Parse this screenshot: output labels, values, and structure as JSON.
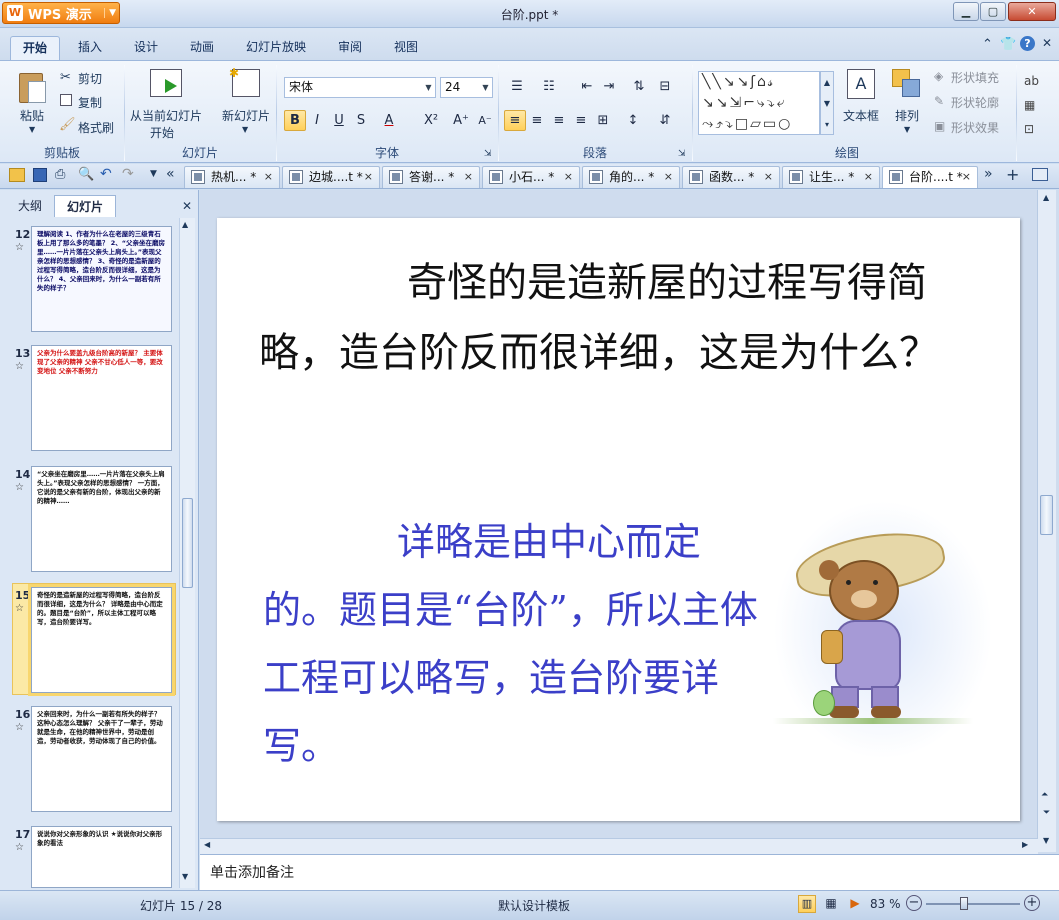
{
  "app": {
    "name": "WPS 演示",
    "window_title": "台阶.ppt *"
  },
  "menu_tabs": [
    "开始",
    "插入",
    "设计",
    "动画",
    "幻灯片放映",
    "审阅",
    "视图"
  ],
  "ribbon": {
    "clipboard": {
      "paste": "粘贴",
      "cut": "剪切",
      "copy": "复制",
      "format_painter": "格式刷",
      "label": "剪贴板"
    },
    "slides": {
      "from_current": "从当前幻灯片",
      "start": "开始",
      "new_slide": "新幻灯片",
      "label": "幻灯片"
    },
    "font": {
      "name": "宋体",
      "size": "24",
      "label": "字体"
    },
    "paragraph": {
      "label": "段落"
    },
    "drawing": {
      "textbox": "文本框",
      "arrange": "排列",
      "shape_fill": "形状填充",
      "shape_outline": "形状轮廓",
      "shape_effects": "形状效果",
      "label": "绘图"
    }
  },
  "doc_tabs": [
    {
      "label": "热机... *",
      "active": false
    },
    {
      "label": "边城....t *",
      "active": false
    },
    {
      "label": "答谢... *",
      "active": false
    },
    {
      "label": "小石... *",
      "active": false
    },
    {
      "label": "角的... *",
      "active": false
    },
    {
      "label": "函数... *",
      "active": false
    },
    {
      "label": "让生... *",
      "active": false
    },
    {
      "label": "台阶....t *",
      "active": true
    }
  ],
  "left_panel": {
    "tabs": [
      "大纲",
      "幻灯片"
    ],
    "thumbnails": [
      {
        "num": "12",
        "text": "理解阅读 1、作者为什么在老屋的三级青石板上用了那么多的笔墨？ 2、“父亲坐在磨房里……一片片落在父亲头上肩头上。”表现父亲怎样的思想感情？ 3、奇怪的是造新屋的过程写得简略，造台阶反而很详细，这是为什么？ 4、父亲回来时，为什么一副若有所失的样子？"
      },
      {
        "num": "13",
        "text": "父亲为什么要盖九级台阶高的新屋？ 主要体现了父亲的精神 父亲不甘心低人一等，要改变地位 父亲不断努力"
      },
      {
        "num": "14",
        "text": "“父亲坐在磨房里……一片片落在父亲头上肩头上。”表现父亲怎样的思想感情？ 一方面，它说的是父亲有新的台阶，体现出父亲的新的精神……"
      },
      {
        "num": "15",
        "text": "奇怪的是造新屋的过程写得简略，造台阶反而很详细，这是为什么？ 详略是由中心而定的。题目是“台阶”，所以主体工程可以略写，造台阶要详写。"
      },
      {
        "num": "16",
        "text": "父亲回来时，为什么一副若有所失的样子？这种心态怎么理解？ 父亲干了一辈子，劳动就是生命，在他的精神世界中，劳动是创造，劳动者收获，劳动体现了自己的价值。"
      },
      {
        "num": "17",
        "text": "说说你对父亲形象的认识 ★说说你对父亲形象的看法"
      }
    ]
  },
  "slide": {
    "question": "奇怪的是造新屋的过程写得简略，造台阶反而很详细，这是为什么？",
    "answer": "详略是由中心而定的。题目是“台阶”，所以主体工程可以略写，造台阶要详写。"
  },
  "notes_placeholder": "单击添加备注",
  "status": {
    "slide_info": "幻灯片 15 / 28",
    "template": "默认设计模板",
    "zoom": "83 %"
  },
  "colors": {
    "accent": "#f07d10",
    "answer_text": "#3b3fc8",
    "selected_thumb": "#f8d66e"
  }
}
